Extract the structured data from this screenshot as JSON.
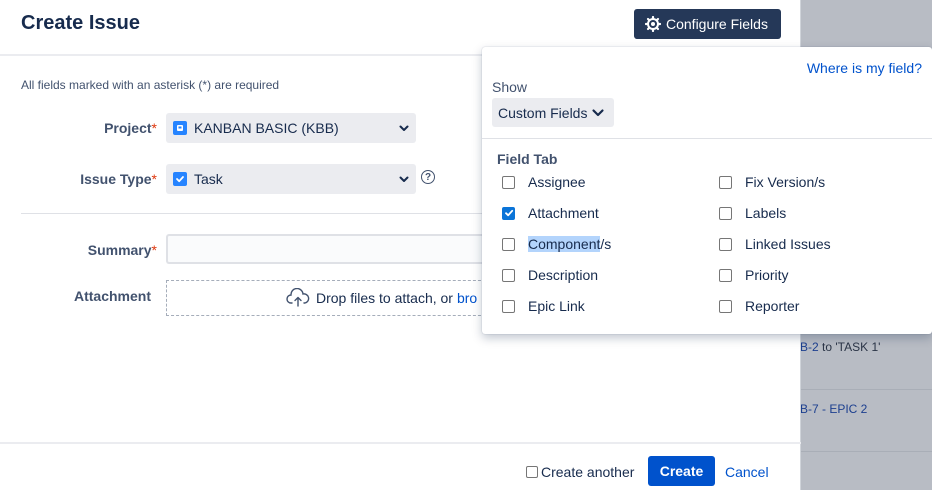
{
  "background": {
    "rows": [
      {
        "link": "B-2",
        "text": "to 'TASK 1'"
      },
      {
        "link": "B-7 - EPIC 2",
        "text": ""
      }
    ]
  },
  "dialog": {
    "title": "Create Issue",
    "configure_button": "Configure Fields",
    "required_note": "All fields marked with an asterisk (*) are required",
    "project": {
      "label": "Project",
      "value": "KANBAN BASIC (KBB)"
    },
    "issue_type": {
      "label": "Issue Type",
      "value": "Task"
    },
    "summary": {
      "label": "Summary",
      "value": ""
    },
    "attachment": {
      "label": "Attachment",
      "drop_text": "Drop files to attach, or",
      "browse_text": "bro"
    },
    "asterisk": "*",
    "help": "?"
  },
  "footer": {
    "create_another": "Create another",
    "create": "Create",
    "cancel": "Cancel"
  },
  "popover": {
    "where_link": "Where is my field?",
    "show_label": "Show",
    "show_value": "Custom Fields",
    "field_tab": "Field Tab",
    "left_options": [
      {
        "label": "Assignee",
        "checked": false
      },
      {
        "label": "Attachment",
        "checked": true
      },
      {
        "label": "Component/s",
        "checked": false
      },
      {
        "label": "Description",
        "checked": false
      },
      {
        "label": "Epic Link",
        "checked": false
      }
    ],
    "right_options": [
      {
        "label": "Fix Version/s",
        "checked": false
      },
      {
        "label": "Labels",
        "checked": false
      },
      {
        "label": "Linked Issues",
        "checked": false
      },
      {
        "label": "Priority",
        "checked": false
      },
      {
        "label": "Reporter",
        "checked": false
      }
    ],
    "component_highlight": "Component",
    "component_rest": "/s"
  },
  "colors": {
    "primary": "#0052cc",
    "configure_bg": "#253858",
    "checkbox_checked": "#0a74d8",
    "required": "#de350b"
  }
}
